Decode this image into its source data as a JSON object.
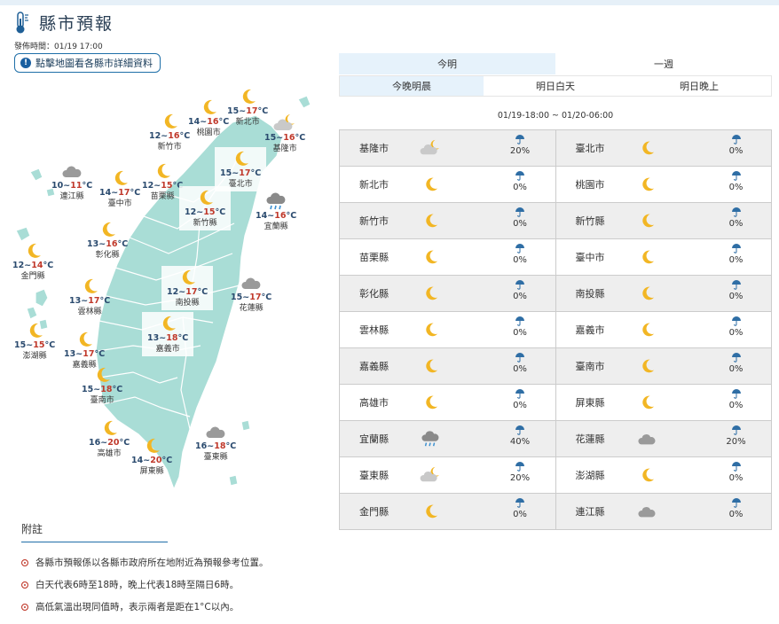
{
  "header": {
    "title": "縣市預報",
    "pubtime": "發佈時間：01/19 17:00",
    "map_link": "點擊地圖看各縣市詳細資料"
  },
  "tabs_main": [
    {
      "label": "今明",
      "active": true
    },
    {
      "label": "一週",
      "active": false
    }
  ],
  "tabs_sub": [
    {
      "label": "今晚明晨",
      "active": true
    },
    {
      "label": "明日白天",
      "active": false
    },
    {
      "label": "明日晚上",
      "active": false
    }
  ],
  "period": "01/19-18:00 ~ 01/20-06:00",
  "map_cities": [
    {
      "name": "新竹市",
      "lo": "12",
      "hi": "16",
      "icon": "moon"
    },
    {
      "name": "桃園市",
      "lo": "14",
      "hi": "16",
      "icon": "moon"
    },
    {
      "name": "新北市",
      "lo": "15",
      "hi": "17",
      "icon": "moon"
    },
    {
      "name": "基隆市",
      "lo": "15",
      "hi": "16",
      "icon": "cloud-moon"
    },
    {
      "name": "臺北市",
      "lo": "15",
      "hi": "17",
      "icon": "moon"
    },
    {
      "name": "連江縣",
      "lo": "10",
      "hi": "11",
      "icon": "cloud"
    },
    {
      "name": "臺中市",
      "lo": "14",
      "hi": "17",
      "icon": "moon"
    },
    {
      "name": "苗栗縣",
      "lo": "12",
      "hi": "15",
      "icon": "moon"
    },
    {
      "name": "新竹縣",
      "lo": "12",
      "hi": "15",
      "icon": "moon"
    },
    {
      "name": "宜蘭縣",
      "lo": "14",
      "hi": "16",
      "icon": "rain-cloud"
    },
    {
      "name": "彰化縣",
      "lo": "13",
      "hi": "16",
      "icon": "moon"
    },
    {
      "name": "金門縣",
      "lo": "12",
      "hi": "14",
      "icon": "moon"
    },
    {
      "name": "南投縣",
      "lo": "12",
      "hi": "17",
      "icon": "moon"
    },
    {
      "name": "花蓮縣",
      "lo": "15",
      "hi": "17",
      "icon": "cloud"
    },
    {
      "name": "雲林縣",
      "lo": "13",
      "hi": "17",
      "icon": "moon"
    },
    {
      "name": "嘉義市",
      "lo": "13",
      "hi": "18",
      "icon": "moon"
    },
    {
      "name": "澎湖縣",
      "lo": "15",
      "hi": "15",
      "icon": "moon"
    },
    {
      "name": "嘉義縣",
      "lo": "13",
      "hi": "17",
      "icon": "moon"
    },
    {
      "name": "臺南市",
      "lo": "15",
      "hi": "18",
      "icon": "moon"
    },
    {
      "name": "高雄市",
      "lo": "16",
      "hi": "20",
      "icon": "moon"
    },
    {
      "name": "臺東縣",
      "lo": "16",
      "hi": "18",
      "icon": "cloud"
    },
    {
      "name": "屏東縣",
      "lo": "14",
      "hi": "20",
      "icon": "moon"
    }
  ],
  "table_rows": [
    [
      {
        "name": "基隆市",
        "icon": "cloud-moon",
        "pop": "20%"
      },
      {
        "name": "臺北市",
        "icon": "moon",
        "pop": "0%"
      }
    ],
    [
      {
        "name": "新北市",
        "icon": "moon",
        "pop": "0%"
      },
      {
        "name": "桃園市",
        "icon": "moon",
        "pop": "0%"
      }
    ],
    [
      {
        "name": "新竹市",
        "icon": "moon",
        "pop": "0%"
      },
      {
        "name": "新竹縣",
        "icon": "moon",
        "pop": "0%"
      }
    ],
    [
      {
        "name": "苗栗縣",
        "icon": "moon",
        "pop": "0%"
      },
      {
        "name": "臺中市",
        "icon": "moon",
        "pop": "0%"
      }
    ],
    [
      {
        "name": "彰化縣",
        "icon": "moon",
        "pop": "0%"
      },
      {
        "name": "南投縣",
        "icon": "moon",
        "pop": "0%"
      }
    ],
    [
      {
        "name": "雲林縣",
        "icon": "moon",
        "pop": "0%"
      },
      {
        "name": "嘉義市",
        "icon": "moon",
        "pop": "0%"
      }
    ],
    [
      {
        "name": "嘉義縣",
        "icon": "moon",
        "pop": "0%"
      },
      {
        "name": "臺南市",
        "icon": "moon",
        "pop": "0%"
      }
    ],
    [
      {
        "name": "高雄市",
        "icon": "moon",
        "pop": "0%"
      },
      {
        "name": "屏東縣",
        "icon": "moon",
        "pop": "0%"
      }
    ],
    [
      {
        "name": "宜蘭縣",
        "icon": "rain-cloud",
        "pop": "40%"
      },
      {
        "name": "花蓮縣",
        "icon": "cloud",
        "pop": "20%"
      }
    ],
    [
      {
        "name": "臺東縣",
        "icon": "cloud-moon",
        "pop": "20%"
      },
      {
        "name": "澎湖縣",
        "icon": "moon",
        "pop": "0%"
      }
    ],
    [
      {
        "name": "金門縣",
        "icon": "moon",
        "pop": "0%"
      },
      {
        "name": "連江縣",
        "icon": "cloud",
        "pop": "0%"
      }
    ]
  ],
  "notes": {
    "title": "附註",
    "items": [
      "各縣市預報係以各縣市政府所在地附近為預報參考位置。",
      "白天代表6時至18時，晚上代表18時至隔日6時。",
      "高低氣溫出現同值時，表示兩者是距在1°C以內。"
    ]
  },
  "colors": {
    "accent": "#1f6fa8",
    "map_land": "#a9ddd6",
    "high_temp": "#c0392b",
    "low_temp": "#2a4a6e",
    "row_alt": "#eeeeee"
  }
}
